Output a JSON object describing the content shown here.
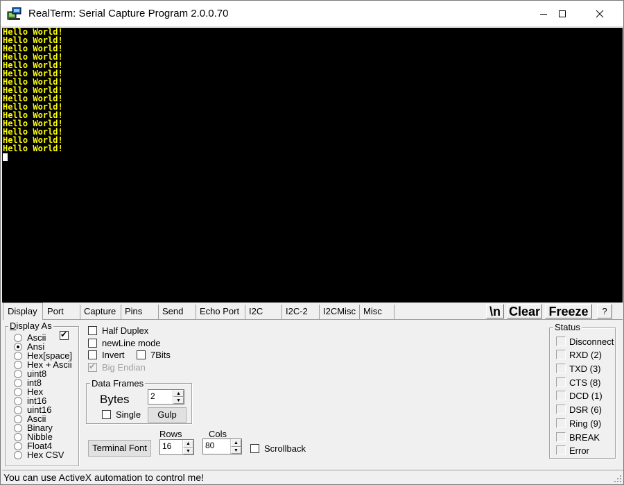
{
  "window": {
    "title": "RealTerm: Serial Capture Program 2.0.0.70"
  },
  "terminal": {
    "lines": [
      "Hello World!",
      "Hello World!",
      "Hello World!",
      "Hello World!",
      "Hello World!",
      "Hello World!",
      "Hello World!",
      "Hello World!",
      "Hello World!",
      "Hello World!",
      "Hello World!",
      "Hello World!",
      "Hello World!",
      "Hello World!",
      "Hello World!"
    ],
    "text_color": "#ffff00",
    "background": "#000000"
  },
  "tabs": [
    {
      "label": "Display",
      "active": true
    },
    {
      "label": "Port"
    },
    {
      "label": "Capture"
    },
    {
      "label": "Pins"
    },
    {
      "label": "Send"
    },
    {
      "label": "Echo Port"
    },
    {
      "label": "I2C"
    },
    {
      "label": "I2C-2"
    },
    {
      "label": "I2CMisc"
    },
    {
      "label": "Misc"
    }
  ],
  "toolbar": {
    "newline_label": "\\n",
    "clear_label": "Clear",
    "freeze_label": "Freeze",
    "help_label": "?"
  },
  "display_as": {
    "label": "Display As",
    "options": [
      "Ascii",
      "Ansi",
      "Hex[space]",
      "Hex + Ascii",
      "uint8",
      "int8",
      "Hex",
      "int16",
      "uint16",
      "Ascii",
      "Binary",
      "Nibble",
      "Float4",
      "Hex CSV"
    ],
    "selected": "Ansi"
  },
  "options": {
    "half_duplex": "Half Duplex",
    "newline_mode": "newLine mode",
    "invert": "Invert",
    "seven_bits": "7Bits",
    "big_endian": "Big Endian"
  },
  "data_frames": {
    "label": "Data Frames",
    "bytes_label": "Bytes",
    "bytes_value": "2",
    "single_label": "Single",
    "gulp_label": "Gulp"
  },
  "terminal_font_label": "Terminal Font",
  "rows": {
    "label": "Rows",
    "value": "16"
  },
  "cols": {
    "label": "Cols",
    "value": "80"
  },
  "scrollback_label": "Scrollback",
  "status_group": {
    "label": "Status",
    "items": [
      "Disconnect",
      "RXD (2)",
      "TXD (3)",
      "CTS (8)",
      "DCD (1)",
      "DSR (6)",
      "Ring (9)",
      "BREAK",
      "Error"
    ]
  },
  "statusbar": {
    "message": "You can use ActiveX automation to control me!"
  }
}
